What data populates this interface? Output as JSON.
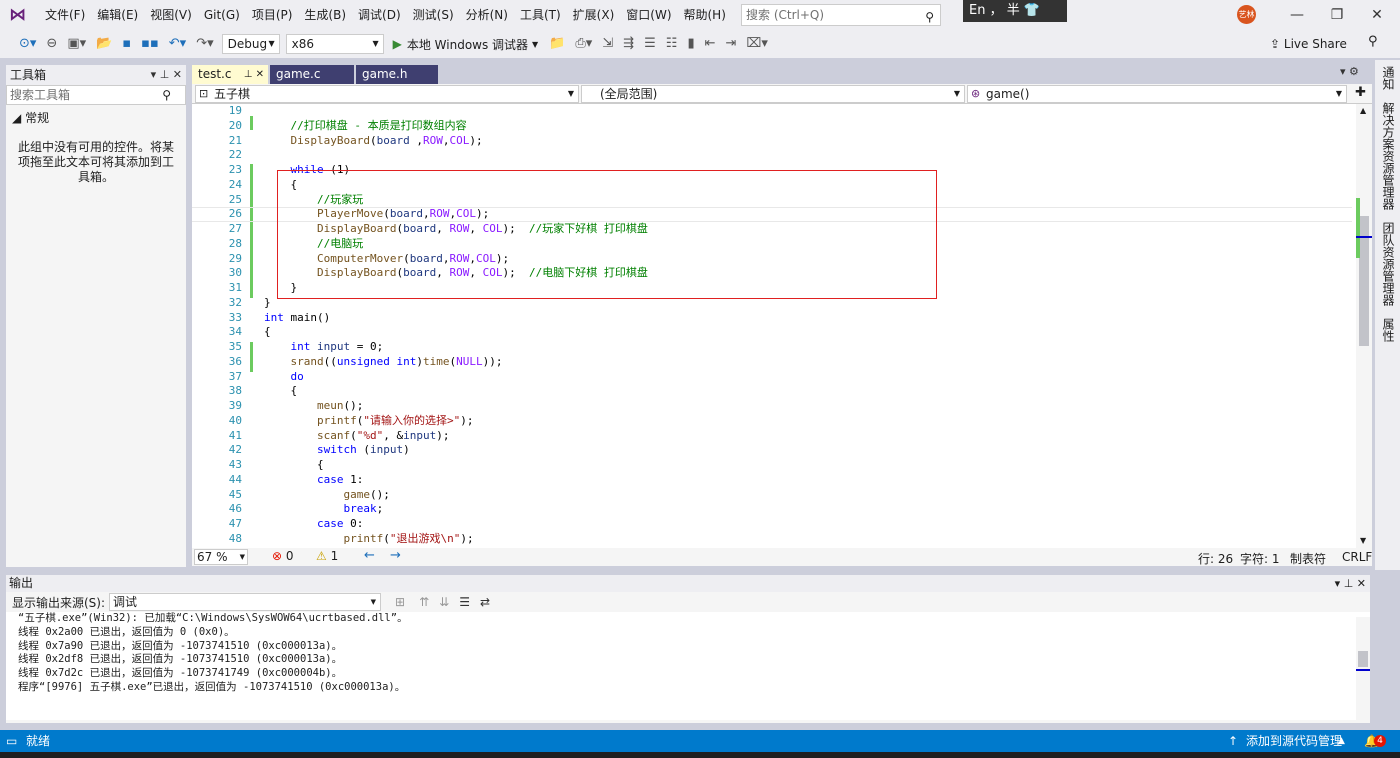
{
  "menubar": {
    "items": [
      "文件(F)",
      "编辑(E)",
      "视图(V)",
      "Git(G)",
      "项目(P)",
      "生成(B)",
      "调试(D)",
      "测试(S)",
      "分析(N)",
      "工具(T)",
      "扩展(X)",
      "窗口(W)",
      "帮助(H)"
    ],
    "search_placeholder": "搜索 (Ctrl+Q)",
    "ime_text": "En ， 半",
    "avatar": "艺林"
  },
  "toolbar": {
    "config": "Debug",
    "platform": "x86",
    "run_label": "本地 Windows 调试器",
    "live_share": "Live Share"
  },
  "toolbox": {
    "title": "工具箱",
    "search_placeholder": "搜索工具箱",
    "group": "常规",
    "empty_text": "此组中没有可用的控件。将某项拖至此文本可将其添加到工具箱。"
  },
  "tabs": [
    {
      "label": "test.c",
      "active": true
    },
    {
      "label": "game.c",
      "active": false
    },
    {
      "label": "game.h",
      "active": false
    }
  ],
  "navbar": {
    "project": "五子棋",
    "scope": "(全局范围)",
    "member": "game()"
  },
  "editor": {
    "line_numbers": [
      "19",
      "20",
      "21",
      "22",
      "23",
      "24",
      "25",
      "26",
      "27",
      "28",
      "29",
      "30",
      "31",
      "32",
      "33",
      "34",
      "35",
      "36",
      "37",
      "38",
      "39",
      "40",
      "41",
      "42",
      "43",
      "44",
      "45",
      "46",
      "47",
      "48"
    ],
    "lines": [
      "",
      "    //打印棋盘 - 本质是打印数组内容",
      "    DisplayBoard(board ,ROW,COL);",
      "",
      "    while (1)",
      "    {",
      "        //玩家玩",
      "        PlayerMove(board,ROW,COL);",
      "        DisplayBoard(board, ROW, COL);  //玩家下好棋 打印棋盘",
      "        //电脑玩",
      "        ComputerMover(board,ROW,COL);",
      "        DisplayBoard(board, ROW, COL);  //电脑下好棋 打印棋盘",
      "    }",
      "}",
      "int main()",
      "{",
      "    int input = 0;",
      "    srand((unsigned int)time(NULL));",
      "    do",
      "    {",
      "        meun();",
      "        printf(\"请输入你的选择>\");",
      "        scanf(\"%d\", &input);",
      "        switch (input)",
      "        {",
      "        case 1:",
      "            game();",
      "            break;",
      "        case 0:",
      "            printf(\"退出游戏\\n\");"
    ]
  },
  "editor_status": {
    "zoom": "67 %",
    "errors": "0",
    "warnings": "1",
    "line": "行: 26",
    "col": "字符: 1",
    "tabs": "制表符",
    "eol": "CRLF"
  },
  "right_tabs": [
    "通知",
    "解决方案资源管理器",
    "团队资源管理器",
    "属性"
  ],
  "output": {
    "title": "输出",
    "source_label": "显示输出来源(S):",
    "source_value": "调试",
    "lines": [
      "“五子棋.exe”(Win32): 已加载“C:\\Windows\\SysWOW64\\ucrtbased.dll”。",
      "线程 0x2a00 已退出，返回值为 0 (0x0)。",
      "线程 0x7a90 已退出，返回值为 -1073741510 (0xc000013a)。",
      "线程 0x2df8 已退出，返回值为 -1073741510 (0xc000013a)。",
      "线程 0x7d2c 已退出，返回值为 -1073741749 (0xc000004b)。",
      "程序“[9976] 五子棋.exe”已退出，返回值为 -1073741510 (0xc000013a)。"
    ]
  },
  "statusbar": {
    "ready": "就绪",
    "source_control": "添加到源代码管理",
    "notifications": "4"
  },
  "colors": {
    "accent": "#007acc",
    "tab_inactive": "#3f3f70",
    "tab_active": "#fffbd1",
    "highlight_box": "#e02020"
  }
}
